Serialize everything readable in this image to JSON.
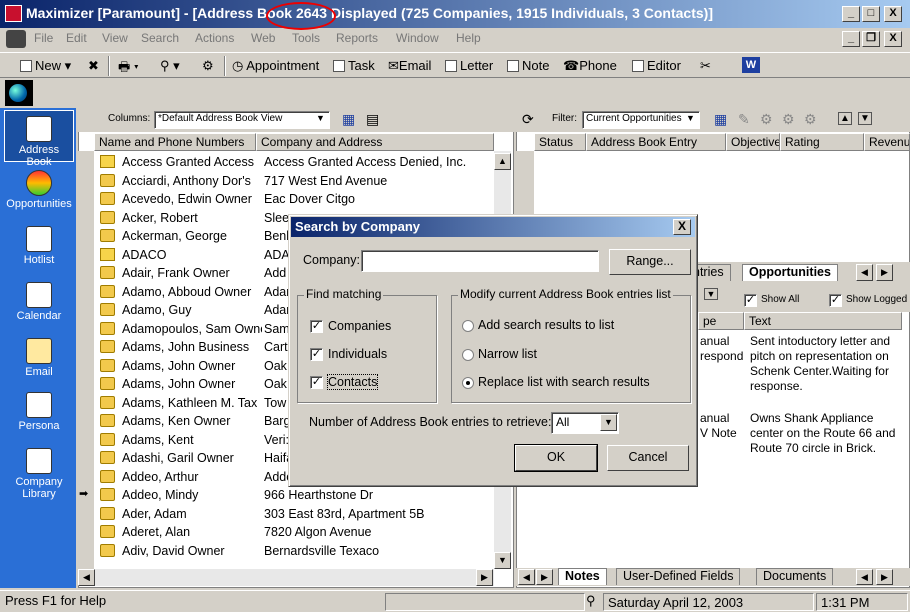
{
  "window": {
    "title": "Maximizer [Paramount] - [Address Book 2643 Displayed (725 Companies, 1915 Individuals, 3 Contacts)]",
    "min": "_",
    "max": "□",
    "close": "X",
    "mdi_min": "_",
    "mdi_restore": "❐",
    "mdi_close": "X"
  },
  "menu": [
    "File",
    "Edit",
    "View",
    "Search",
    "Actions",
    "Web",
    "Tools",
    "Reports",
    "Window",
    "Help"
  ],
  "toolbar": {
    "new": "New",
    "appointment": "Appointment",
    "task": "Task",
    "email": "Email",
    "letter": "Letter",
    "note": "Note",
    "phone": "Phone",
    "editor": "Editor",
    "word": "W"
  },
  "sidebar": [
    {
      "label": "Address Book"
    },
    {
      "label": "Opportunities"
    },
    {
      "label": "Hotlist"
    },
    {
      "label": "Calendar"
    },
    {
      "label": "Email"
    },
    {
      "label": "Persona"
    },
    {
      "label": "Company Library"
    }
  ],
  "left": {
    "columns_label": "Columns:",
    "columns_value": "*Default Address Book View",
    "col_name": "Name and Phone Numbers",
    "col_company": "Company and Address",
    "rows": [
      {
        "name": "Access Granted Access",
        "company": "Access Granted Access Denied, Inc."
      },
      {
        "name": "Acciardi, Anthony   Dor's",
        "company": "717 West End  Avenue"
      },
      {
        "name": "Acevedo, Edwin   Owner",
        "company": "Eac Dover Citgo"
      },
      {
        "name": "Acker, Robert",
        "company": "Slee"
      },
      {
        "name": "Ackerman, George",
        "company": "Benl"
      },
      {
        "name": "ADACO",
        "company": "ADA"
      },
      {
        "name": "Adair, Frank   Owner",
        "company": "Add"
      },
      {
        "name": "Adamo, Abboud   Owner",
        "company": "Adar"
      },
      {
        "name": "Adamo, Guy",
        "company": "Adar"
      },
      {
        "name": "Adamopoulos, Sam   Owner",
        "company": "Sam"
      },
      {
        "name": "Adams, John   Business",
        "company": "Cart"
      },
      {
        "name": "Adams, John   Owner",
        "company": "Oak"
      },
      {
        "name": "Adams, John   Owner",
        "company": "Oak"
      },
      {
        "name": "Adams, Kathleen M.   Tax",
        "company": "Tow"
      },
      {
        "name": "Adams, Ken   Owner",
        "company": "Barg"
      },
      {
        "name": "Adams, Kent",
        "company": "Veri:"
      },
      {
        "name": "Adashi, Garil   Owner",
        "company": "Haifa"
      },
      {
        "name": "Addeo, Arthur",
        "company": "Adde"
      },
      {
        "name": "Addeo, Mindy",
        "company": "966 Hearthstone Dr"
      },
      {
        "name": "Ader, Adam",
        "company": "303 East 83rd, Apartment 5B"
      },
      {
        "name": "Aderet, Alan",
        "company": "7820 Algon Avenue"
      },
      {
        "name": "Adiv, David   Owner",
        "company": "Bernardsville Texaco"
      }
    ]
  },
  "right": {
    "filter_label": "Filter:",
    "filter_value": "Current Opportunities",
    "cols": [
      "Status",
      "Address Book Entry",
      "Objective",
      "Rating",
      "Revenue"
    ],
    "tabs": [
      "ntries",
      "Opportunities"
    ],
    "show_all": "Show All",
    "show_logged": "Show Logged",
    "notes_col": "Text",
    "type_col": "pe",
    "notes": [
      {
        "type": "anual\nrespond",
        "text": "Sent intoductory letter and pitch on representation on Schenk Center.Waiting for response."
      },
      {
        "type": "anual\nV Note",
        "text": "Owns Shank Appliance center on the Route 66 and Route 70 circle in Brick."
      }
    ],
    "bottom_tabs": [
      "Notes",
      "User-Defined Fields",
      "Documents"
    ]
  },
  "status": {
    "help": "Press F1 for Help",
    "date": "Saturday  April 12, 2003",
    "time": "1:31 PM"
  },
  "dialog": {
    "title": "Search by Company",
    "close": "X",
    "company_label": "Company:",
    "company_value": "",
    "range": "Range...",
    "find_label": "Find matching",
    "companies": "Companies",
    "individuals": "Individuals",
    "contacts": "Contacts",
    "check": "✓",
    "modify_label": "Modify current Address Book entries list",
    "opt_add": "Add search results to list",
    "opt_narrow": "Narrow list",
    "opt_replace": "Replace list with search results",
    "num_label": "Number of Address Book entries to retrieve:",
    "num_value": "All",
    "ok": "OK",
    "cancel": "Cancel"
  }
}
